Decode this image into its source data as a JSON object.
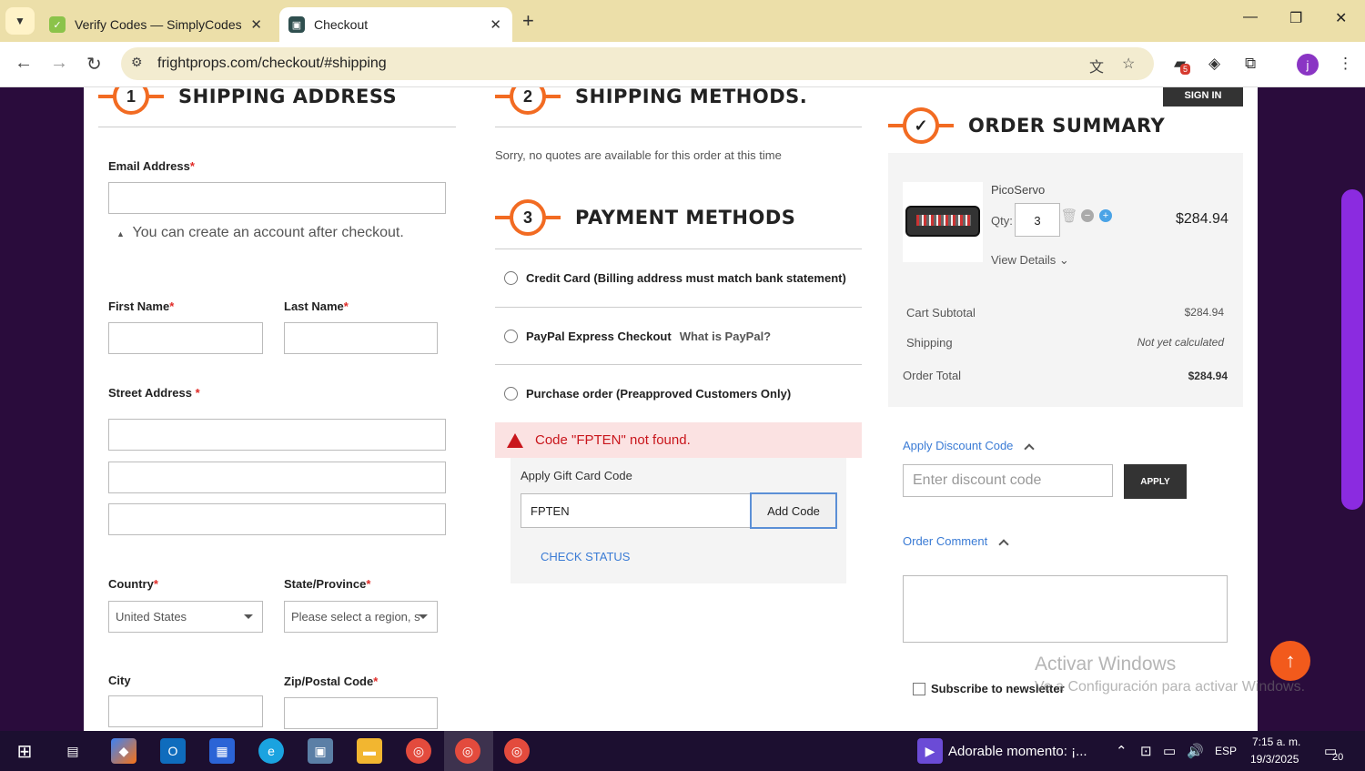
{
  "browser": {
    "tabs": [
      {
        "title": "Verify Codes — SimplyCodes"
      },
      {
        "title": "Checkout"
      }
    ],
    "url": "frightprops.com/checkout/#shipping",
    "extension_badge": "5",
    "profile_initial": "j"
  },
  "shipping": {
    "step_number": "1",
    "title": "SHIPPING ADDRESS",
    "email_label": "Email Address",
    "account_note": "You can create an account after checkout.",
    "first_name_label": "First Name",
    "last_name_label": "Last Name",
    "street_label": "Street Address",
    "country_label": "Country",
    "country_value": "United States",
    "state_label": "State/Province",
    "state_placeholder": "Please select a region, s",
    "city_label": "City",
    "zip_label": "Zip/Postal Code",
    "required_mark": "*"
  },
  "shipping_methods": {
    "step_number": "2",
    "title": "SHIPPING METHODS.",
    "message": "Sorry, no quotes are available for this order at this time"
  },
  "payment": {
    "step_number": "3",
    "title": "PAYMENT METHODS",
    "options": [
      {
        "label": "Credit Card (Billing address must match bank statement)",
        "extra": ""
      },
      {
        "label": "PayPal Express Checkout",
        "extra": "What is PayPal?"
      },
      {
        "label": "Purchase order (Preapproved Customers Only)",
        "extra": ""
      }
    ],
    "error": "Code \"FPTEN\" not found.",
    "gift_title": "Apply Gift Card Code",
    "gift_code_value": "FPTEN",
    "add_code": "Add Code",
    "check_status": "CHECK STATUS"
  },
  "summary": {
    "sign_in": "SIGN IN",
    "step_mark": "✓",
    "title": "ORDER SUMMARY",
    "product_name": "PicoServo",
    "qty_label": "Qty:",
    "qty_value": "3",
    "price": "$284.94",
    "view_details": "View Details",
    "rows": [
      {
        "label": "Cart Subtotal",
        "value": "$284.94"
      },
      {
        "label": "Shipping",
        "value": "Not yet calculated"
      },
      {
        "label": "Order Total",
        "value": "$284.94"
      }
    ],
    "discount_link": "Apply Discount Code",
    "discount_placeholder": "Enter discount code",
    "apply_label": "APPLY",
    "comment_link": "Order Comment",
    "newsletter_label": "Subscribe to newsletter"
  },
  "watermark": {
    "line1": "Activar Windows",
    "line2": "Ve a Configuración para activar Windows."
  },
  "taskbar": {
    "media_title": "Adorable momento: ¡...",
    "language": "ESP",
    "time": "7:15 a. m.",
    "date": "19/3/2025",
    "notifications": "20"
  },
  "colors": {
    "accent": "#f26b22",
    "link": "#3a7bd5",
    "error": "#c9161c"
  }
}
